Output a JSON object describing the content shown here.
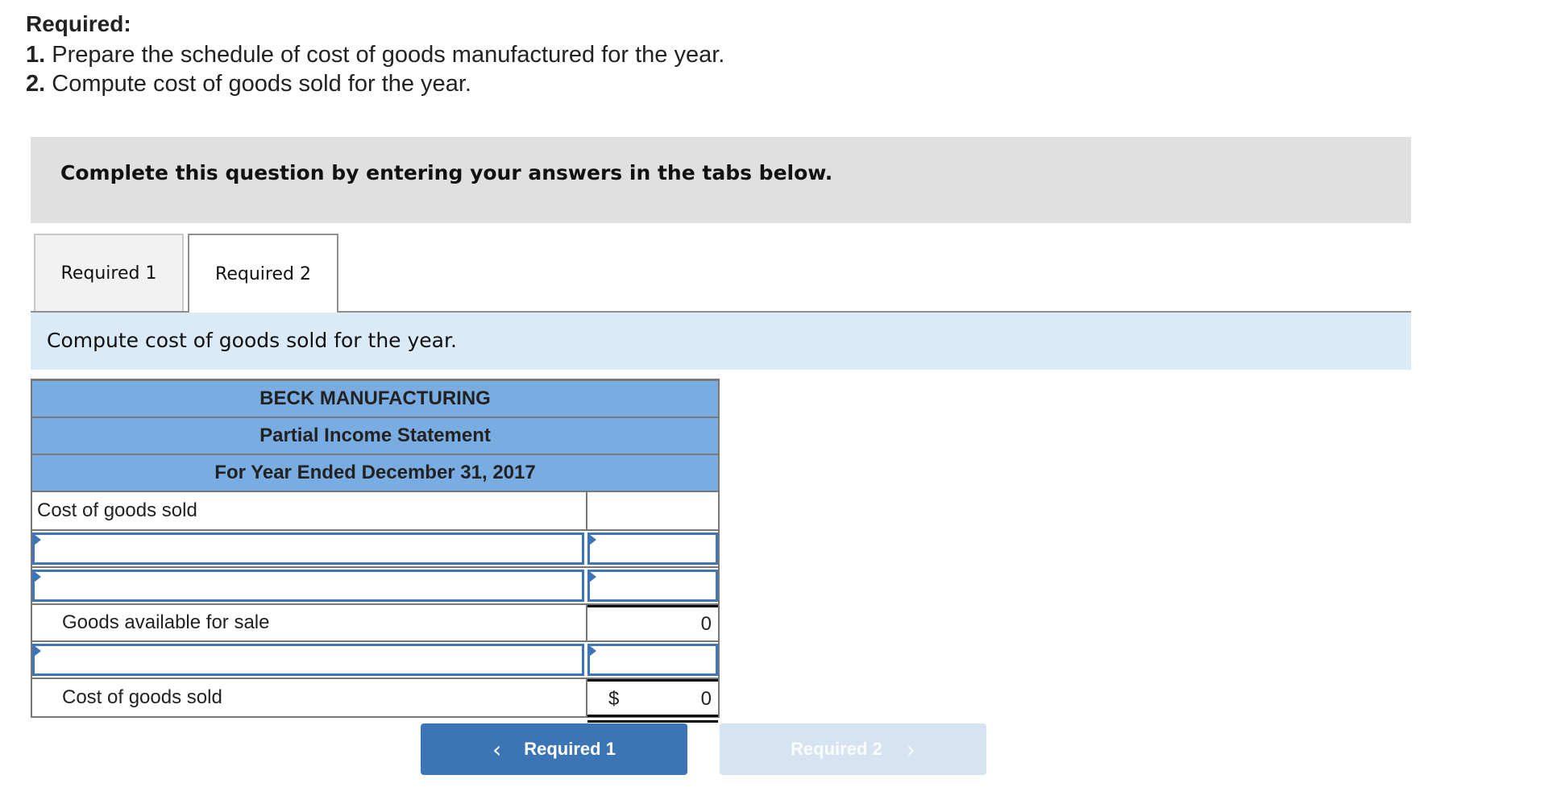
{
  "required": {
    "heading": "Required:",
    "items": [
      {
        "num": "1.",
        "text": "Prepare the schedule of cost of goods manufactured for the year."
      },
      {
        "num": "2.",
        "text": "Compute cost of goods sold for the year."
      }
    ]
  },
  "instructions": "Complete this question by entering your answers in the tabs below.",
  "tabs": [
    {
      "label": "Required 1",
      "active": false
    },
    {
      "label": "Required 2",
      "active": true
    }
  ],
  "prompt": "Compute cost of goods sold for the year.",
  "statement": {
    "company": "BECK MANUFACTURING",
    "title": "Partial Income Statement",
    "period": "For Year Ended December 31, 2017",
    "rows": [
      {
        "type": "label",
        "label": "Cost of goods sold",
        "value": ""
      },
      {
        "type": "input",
        "label": "",
        "value": ""
      },
      {
        "type": "input",
        "label": "",
        "value": ""
      },
      {
        "type": "total",
        "label": "Goods available for sale",
        "value": "0"
      },
      {
        "type": "input",
        "label": "",
        "value": ""
      },
      {
        "type": "grand-total",
        "label": "Cost of goods sold",
        "currency": "$",
        "value": "0"
      }
    ]
  },
  "nav": {
    "prev_label": "Required 1",
    "next_label": "Required 2",
    "prev_icon": "chevron-left-icon",
    "next_icon": "chevron-right-icon",
    "prev_glyph": "‹",
    "next_glyph": "›"
  },
  "colors": {
    "header_blue": "#79ade2",
    "input_border": "#3d75b8",
    "primary_button": "#3c75b6",
    "disabled_button": "#d6e3f1",
    "prompt_bg": "#dbeaf7",
    "instructions_bg": "#e0e0e0"
  }
}
